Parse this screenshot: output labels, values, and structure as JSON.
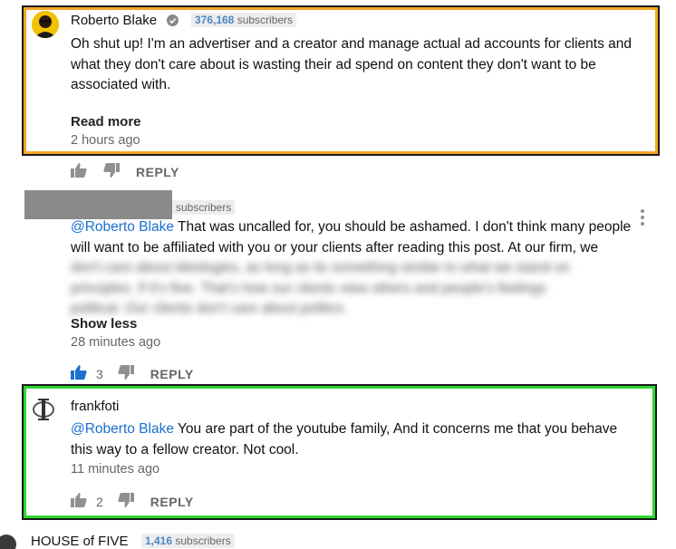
{
  "comments": [
    {
      "author": "Roberto Blake",
      "subscriber_count": "376,168",
      "subscriber_label": "subscribers",
      "text": "Oh shut up! I'm an advertiser and a creator and manage actual ad accounts for clients and what they don't care about is wasting their ad spend on content they don't want to be associated with.",
      "read_more": "Read more",
      "time": "2 hours ago",
      "reply": "REPLY"
    },
    {
      "subscriber_label": "subscribers",
      "mention": "@Roberto Blake",
      "text_line1": " That was uncalled for, you should be ashamed. I don't think many people",
      "text_line2": "will want to be affiliated with you or your clients after reading this post. At our firm, we",
      "text_blur1": "don't care about ideologies, as long as its something similar to what we stand on",
      "text_blur2": "principles. If it's fine. That's how our clients view others and people's feelings",
      "text_blur3": "political. Our clients don't care about politics.",
      "show_less": "Show less",
      "time": "28 minutes ago",
      "likes": "3",
      "reply": "REPLY"
    },
    {
      "author": "frankfoti",
      "mention": "@Roberto Blake",
      "text_line1": " You are part of the youtube family, And it concerns me that you behave",
      "text_line2": "this way to a fellow creator. Not cool.",
      "time": "11 minutes ago",
      "likes": "2",
      "reply": "REPLY"
    },
    {
      "author": "HOUSE of FIVE",
      "subscriber_count": "1,416",
      "subscriber_label": "subscribers"
    }
  ],
  "colors": {
    "highlight_orange": "#f5a623",
    "highlight_green": "#2fd62f",
    "mention_blue": "#1a6fcf",
    "active_like_blue": "#1a6fcf"
  }
}
